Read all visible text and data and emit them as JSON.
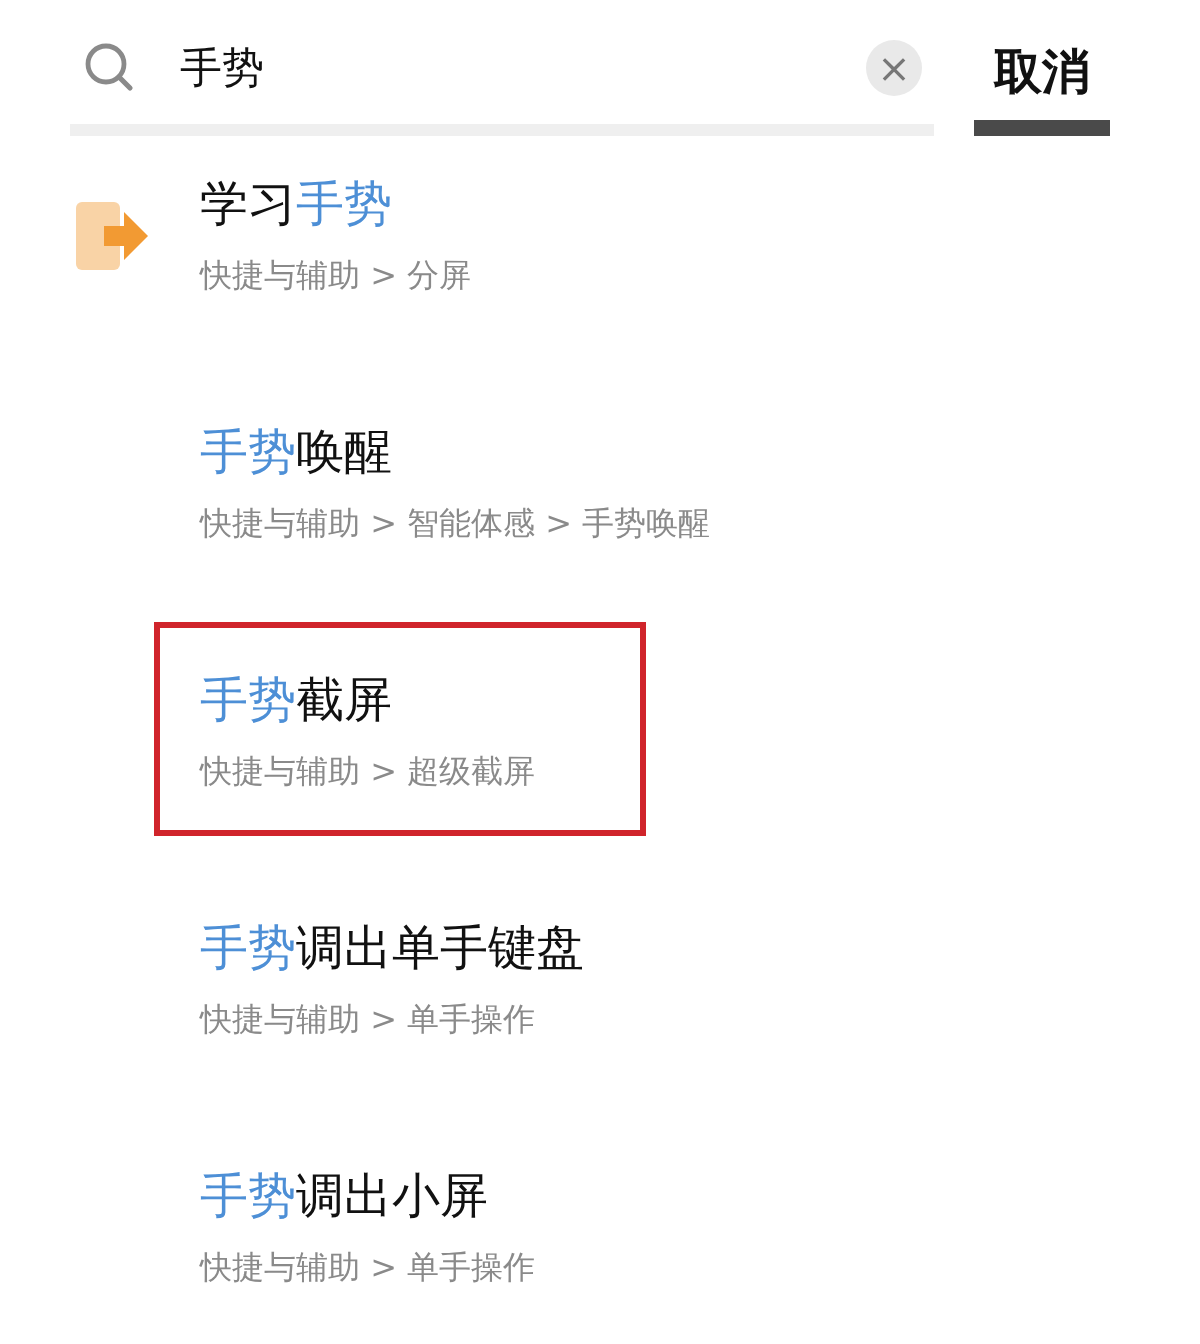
{
  "search": {
    "value": "手势",
    "clear_label": "×",
    "cancel_label": "取消"
  },
  "results": [
    {
      "has_icon": true,
      "outlined": false,
      "title": [
        {
          "text": "学习",
          "match": false
        },
        {
          "text": "手势",
          "match": true
        }
      ],
      "path": "快捷与辅助 > 分屏"
    },
    {
      "has_icon": false,
      "outlined": false,
      "title": [
        {
          "text": "手势",
          "match": true
        },
        {
          "text": "唤醒",
          "match": false
        }
      ],
      "path": "快捷与辅助 > 智能体感 > 手势唤醒"
    },
    {
      "has_icon": false,
      "outlined": true,
      "title": [
        {
          "text": "手势",
          "match": true
        },
        {
          "text": "截屏",
          "match": false
        }
      ],
      "path": "快捷与辅助 > 超级截屏"
    },
    {
      "has_icon": false,
      "outlined": false,
      "title": [
        {
          "text": "手势",
          "match": true
        },
        {
          "text": "调出单手键盘",
          "match": false
        }
      ],
      "path": "快捷与辅助 > 单手操作"
    },
    {
      "has_icon": false,
      "outlined": false,
      "title": [
        {
          "text": "手势",
          "match": true
        },
        {
          "text": "调出小屏",
          "match": false
        }
      ],
      "path": "快捷与辅助 > 单手操作"
    }
  ]
}
